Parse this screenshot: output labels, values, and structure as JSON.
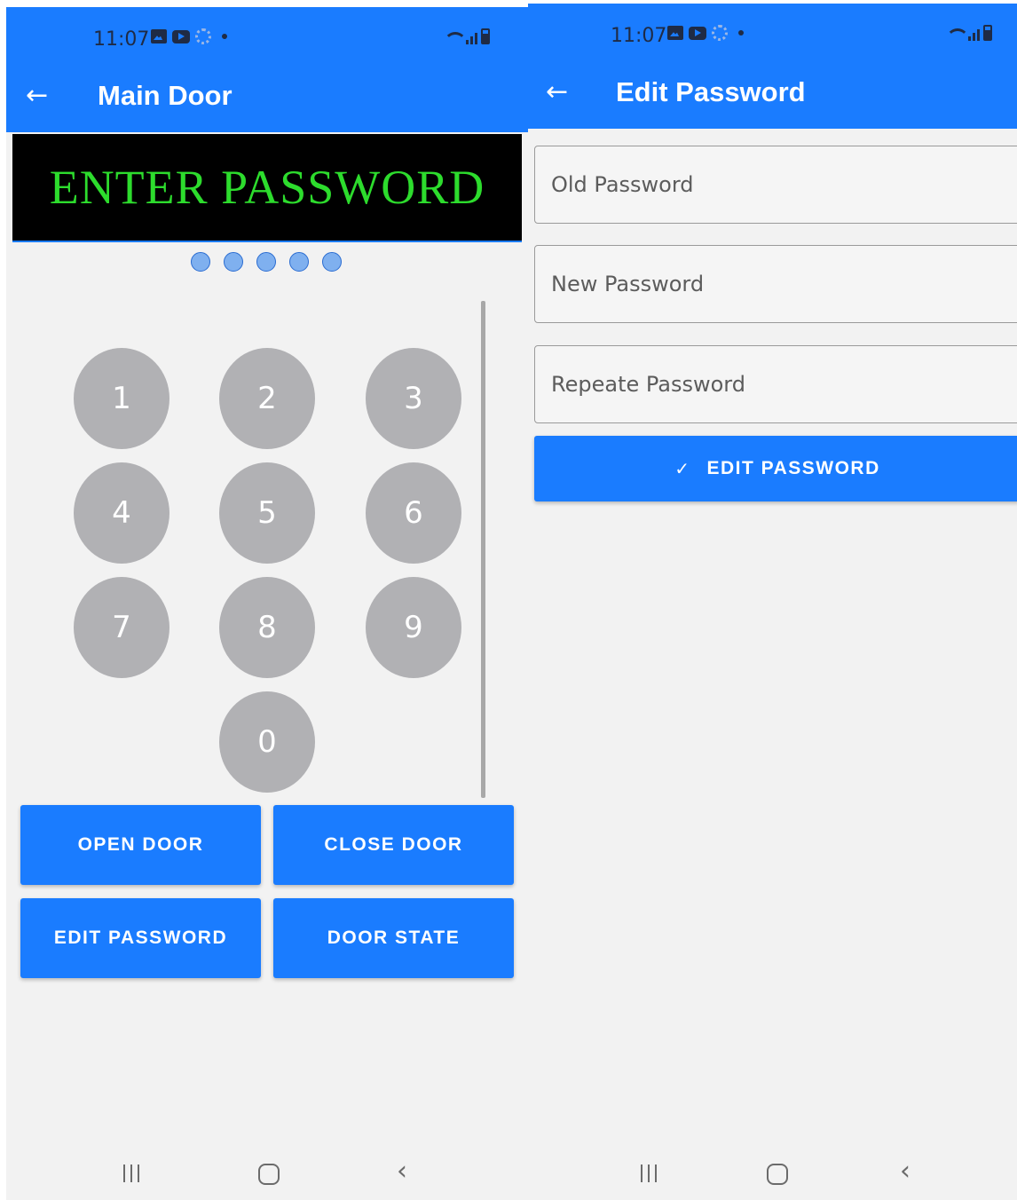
{
  "left": {
    "status_bar": {
      "time": "11:07"
    },
    "app_bar": {
      "title": "Main Door"
    },
    "display": {
      "text": "ENTER PASSWORD"
    },
    "pin_dots": 5,
    "keypad": {
      "keys": [
        "1",
        "2",
        "3",
        "4",
        "5",
        "6",
        "7",
        "8",
        "9",
        "0"
      ]
    },
    "buttons": {
      "open_door": "OPEN DOOR",
      "close_door": "CLOSE DOOR",
      "edit_password": "EDIT PASSWORD",
      "door_state": "DOOR STATE"
    }
  },
  "right": {
    "status_bar": {
      "time": "11:07"
    },
    "app_bar": {
      "title": "Edit Password"
    },
    "fields": {
      "old_placeholder": "Old Password",
      "new_placeholder": "New Password",
      "repeat_placeholder": "Repeate Password"
    },
    "edit_button": "EDIT PASSWORD"
  },
  "colors": {
    "primary": "#1a7cff",
    "key_gray": "#b1b1b4",
    "display_green": "#2ddc2d",
    "background": "#f2f2f2"
  },
  "icons": {
    "back": "arrow-left-icon",
    "check": "check-icon",
    "nav_recents": "recents-icon",
    "nav_home": "home-icon",
    "nav_back": "chevron-left-icon"
  }
}
